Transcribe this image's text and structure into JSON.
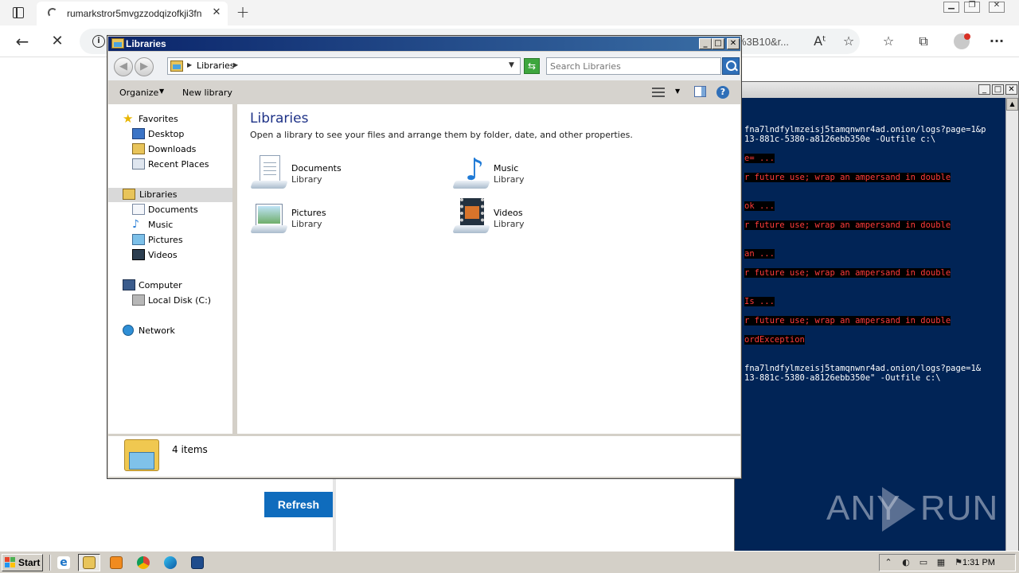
{
  "browser": {
    "tab_title": "rumarkstror5mvgzzodqizofkji3fn",
    "tab_close": "✕",
    "new_tab": "+",
    "url_tail": "%3B10&r...",
    "window_buttons": {
      "minimize": "▁",
      "maximize": "❐",
      "close": "✕"
    },
    "icons": {
      "back": "←",
      "stop": "✕",
      "info": "i",
      "read_aloud": "Aᵗ",
      "add_favorite": "☆",
      "favorites": "☆",
      "collections": "⧉",
      "more": "···"
    }
  },
  "page": {
    "refresh_button": "Refresh"
  },
  "powershell": {
    "window_buttons": {
      "minimize": "_",
      "maximize": "□",
      "close": "✕"
    },
    "lines": [
      {
        "text": "fna7lndfylmzeisj5tamqnwnr4ad.onion/logs?page=1&p",
        "error": false
      },
      {
        "text": "13-881c-5380-a8126ebb350e -Outfile c:\\",
        "error": false
      },
      {
        "text": "e= ...",
        "error": true
      },
      {
        "text": "r future use; wrap an ampersand in double",
        "error": true
      },
      {
        "text": "ok ...",
        "error": true
      },
      {
        "text": "r future use; wrap an ampersand in double",
        "error": true
      },
      {
        "text": "an ...",
        "error": true
      },
      {
        "text": "r future use; wrap an ampersand in double",
        "error": true
      },
      {
        "text": "Is ...",
        "error": true
      },
      {
        "text": "r future use; wrap an ampersand in double",
        "error": true
      },
      {
        "text": "ordException",
        "error": true
      },
      {
        "text": "fna7lndfylmzeisj5tamqnwnr4ad.onion/logs?page=1&",
        "error": false
      },
      {
        "text": "13-881c-5380-a8126ebb350e\" -Outfile c:\\",
        "error": false
      }
    ]
  },
  "watermark": {
    "left": "ANY",
    "right": "RUN"
  },
  "explorer": {
    "title": "Libraries",
    "window_buttons": {
      "minimize": "_",
      "maximize": "□",
      "close": "✕"
    },
    "address": "Libraries",
    "search_placeholder": "Search Libraries",
    "commands": {
      "organize": "Organize",
      "new_library": "New library"
    },
    "nav": {
      "favorites": "Favorites",
      "desktop": "Desktop",
      "downloads": "Downloads",
      "recent_places": "Recent Places",
      "libraries": "Libraries",
      "documents": "Documents",
      "music": "Music",
      "pictures": "Pictures",
      "videos": "Videos",
      "computer": "Computer",
      "local_disk": "Local Disk (C:)",
      "network": "Network"
    },
    "content": {
      "title": "Libraries",
      "subtitle": "Open a library to see your files and arrange them by folder, date, and other properties.",
      "items": [
        {
          "name": "Documents",
          "type": "Library"
        },
        {
          "name": "Music",
          "type": "Library"
        },
        {
          "name": "Pictures",
          "type": "Library"
        },
        {
          "name": "Videos",
          "type": "Library"
        }
      ]
    },
    "status": "4 items"
  },
  "taskbar": {
    "start": "Start",
    "clock": "1:31 PM"
  },
  "colors": {
    "console_bg": "#012456",
    "console_error": "#ff3b3b",
    "title_bar": "#0a246a",
    "accent_button": "#0f6cbd"
  }
}
